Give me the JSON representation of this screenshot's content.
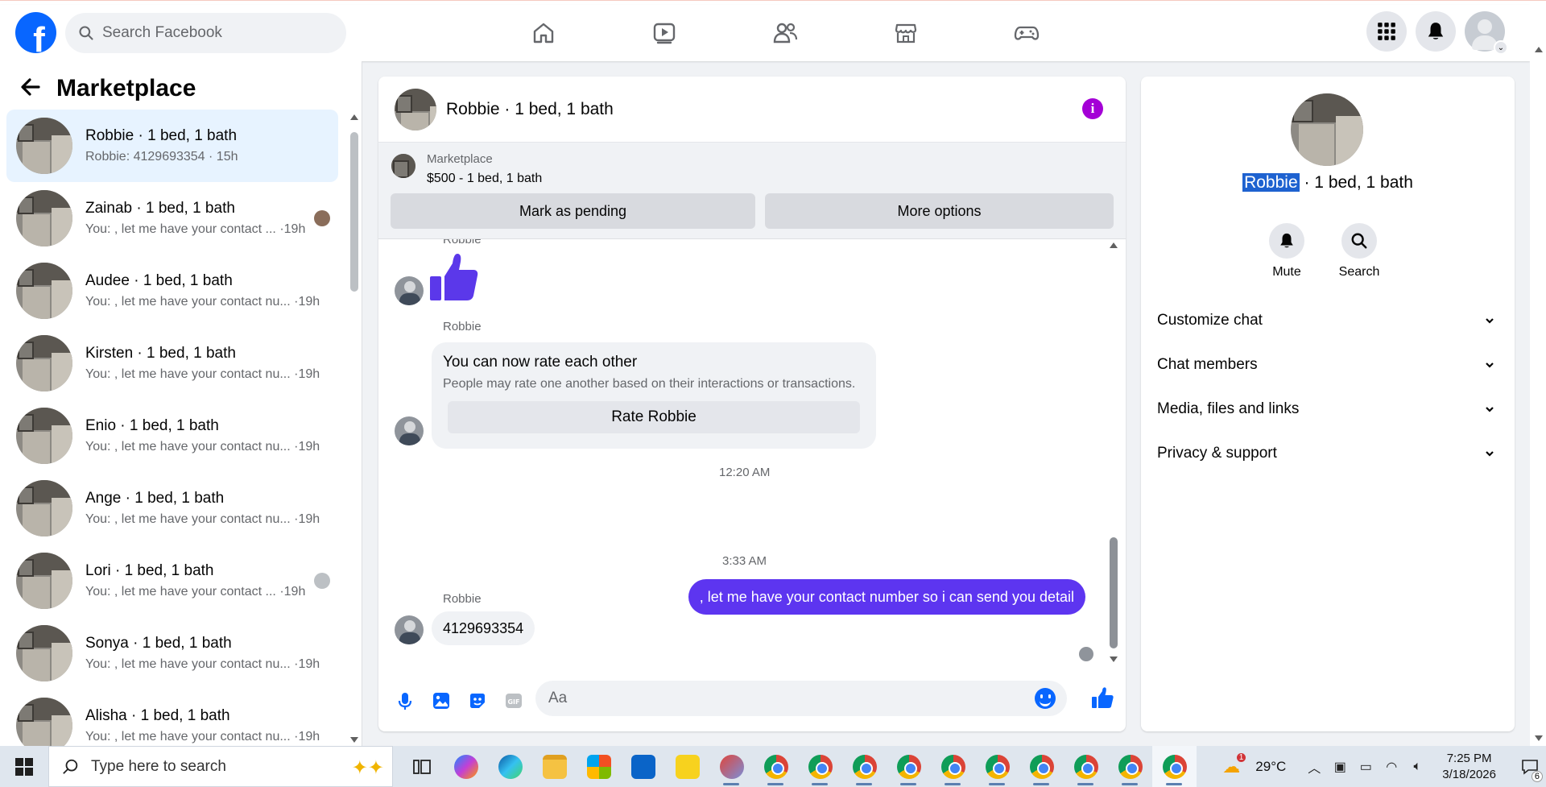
{
  "header": {
    "search_placeholder": "Search Facebook",
    "nav": [
      "home-icon",
      "video-icon",
      "friends-icon",
      "marketplace-icon",
      "gaming-icon"
    ],
    "right": [
      "menu-grid-icon",
      "notifications-icon",
      "account-avatar"
    ]
  },
  "sidebar": {
    "title": "Marketplace",
    "conversations": [
      {
        "name": "Robbie · 1 bed, 1 bath",
        "message": "Robbie: 4129693354 · 15h"
      },
      {
        "name": "Zainab · 1 bed, 1 bath",
        "message": "You: , let me have your contact ... ·19h"
      },
      {
        "name": "Audee · 1 bed, 1 bath",
        "message": "You: , let me have your contact nu... ·19h"
      },
      {
        "name": "Kirsten · 1 bed, 1 bath",
        "message": "You: , let me have your contact nu... ·19h"
      },
      {
        "name": "Enio · 1 bed, 1 bath",
        "message": "You: , let me have your contact nu... ·19h"
      },
      {
        "name": "Ange · 1 bed, 1 bath",
        "message": "You: , let me have your contact nu... ·19h"
      },
      {
        "name": "Lori · 1 bed, 1 bath",
        "message": "You: , let me have your contact ... ·19h"
      },
      {
        "name": "Sonya · 1 bed, 1 bath",
        "message": "You: , let me have your contact nu... ·19h"
      },
      {
        "name": "Alisha · 1 bed, 1 bath",
        "message": "You: , let me have your contact nu... ·19h"
      }
    ]
  },
  "chat": {
    "title": "Robbie · 1 bed, 1 bath",
    "listing": {
      "source": "Marketplace",
      "price_line": "$500 - 1 bed, 1 bath",
      "pending_label": "Mark as pending",
      "options_label": "More options"
    },
    "messages": {
      "sender_top": "Robbie",
      "sender_card": "Robbie",
      "rate_title": "You can now rate each other",
      "rate_subtitle": "People may rate one another based on their interactions or transactions.",
      "rate_button": "Rate Robbie",
      "time1": "12:20 AM",
      "outgoing": ", let me have your contact number so i can send you detail",
      "time2": "3:33 AM",
      "sender_last": "Robbie",
      "incoming": "4129693354"
    },
    "composer_placeholder": "Aa"
  },
  "info": {
    "name_highlight": "Robbie",
    "name_rest": " · 1 bed, 1 bath",
    "mute_label": "Mute",
    "search_label": "Search",
    "sections": [
      "Customize chat",
      "Chat members",
      "Media, files and links",
      "Privacy & support"
    ]
  },
  "taskbar": {
    "search_placeholder": "Type here to search",
    "weather": "29°C",
    "weather_badge": "1",
    "time": "7:25 PM",
    "date": "3/18/2026",
    "notifications": "6"
  },
  "colors": {
    "brand": "#0866ff",
    "outgoing_bubble": "#5d35f0",
    "info_icon": "#a400d6",
    "active_conversation": "#e7f3ff"
  }
}
